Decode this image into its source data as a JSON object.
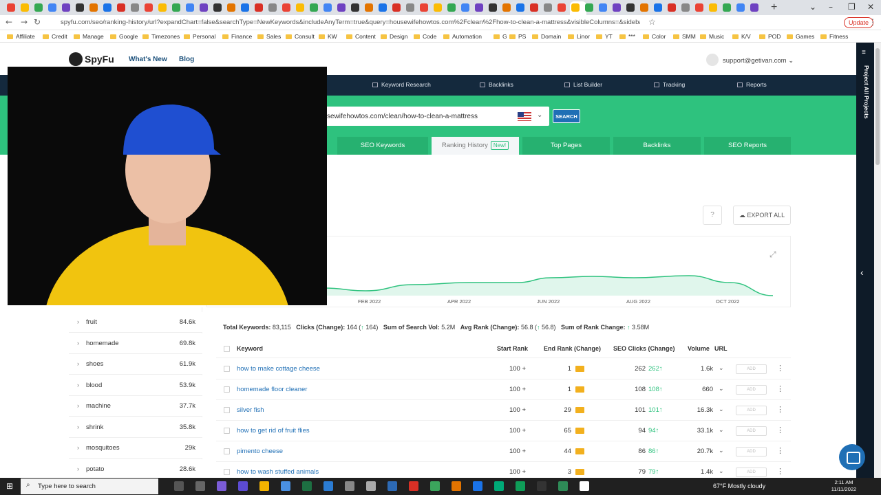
{
  "browser": {
    "url": "spyfu.com/seo/ranking-history/url?expandChart=false&searchType=NewKeywords&includeAnyTerm=true&query=housewifehowtos.com%2Fclean%2Fhow-to-clean-a-mattress&visibleColumns=&sidebarContext=...",
    "update_label": "Update",
    "bookmarks": [
      "Affiliate",
      "Credit",
      "Manage",
      "Google",
      "Timezones",
      "Personal",
      "Finance",
      "Sales",
      "Consult",
      "KW",
      "Content",
      "Design",
      "Code",
      "Automation",
      "G",
      "PS",
      "Domain",
      "Linor",
      "YT",
      "***",
      "Color",
      "SMM",
      "Music",
      "K/V",
      "POD",
      "Games",
      "Fitness"
    ]
  },
  "site": {
    "logo": "SpyFu",
    "links": {
      "whats_new": "What's New",
      "blog": "Blog"
    },
    "account": "support@getivan.com",
    "nav": [
      "Keyword Research",
      "Backlinks",
      "List Builder",
      "Tracking",
      "Reports"
    ],
    "rail_label": "Project All Projects",
    "search": {
      "value": "sewifehowtos.com/clean/how-to-clean-a-mattress",
      "button": "SEARCH"
    },
    "tabs": [
      "SEO Keywords",
      "Ranking History",
      "Top Pages",
      "Backlinks",
      "SEO Reports"
    ],
    "new_badge": "New!",
    "export_label": "EXPORT ALL",
    "help_label": "?"
  },
  "chart_data": {
    "type": "area",
    "x": [
      "FEB 2022",
      "APR 2022",
      "JUN 2022",
      "AUG 2022",
      "OCT 2022"
    ],
    "title": "",
    "xlabel": "",
    "ylabel": ""
  },
  "sidebar_terms": [
    {
      "term": "fruit",
      "count": "84.6k"
    },
    {
      "term": "homemade",
      "count": "69.8k"
    },
    {
      "term": "shoes",
      "count": "61.9k"
    },
    {
      "term": "blood",
      "count": "53.9k"
    },
    {
      "term": "machine",
      "count": "37.7k"
    },
    {
      "term": "shrink",
      "count": "35.8k"
    },
    {
      "term": "mosquitoes",
      "count": "29k"
    },
    {
      "term": "potato",
      "count": "28.6k"
    }
  ],
  "summary": {
    "total_keywords_label": "Total Keywords:",
    "total_keywords": "83,115",
    "clicks_label": "Clicks (Change):",
    "clicks": "164",
    "clicks_change": "164",
    "search_vol_label": "Sum of Search Vol:",
    "search_vol": "5.2M",
    "avg_rank_label": "Avg Rank (Change):",
    "avg_rank": "56.8",
    "avg_rank_change": "56.8",
    "rank_change_label": "Sum of Rank Change:",
    "rank_change": "3.58M"
  },
  "table": {
    "headers": {
      "keyword": "Keyword",
      "start": "Start Rank",
      "end": "End Rank (Change)",
      "clicks": "SEO Clicks (Change)",
      "volume": "Volume",
      "url": "URL"
    },
    "add_label": "ADD",
    "rows": [
      {
        "keyword": "how to make cottage cheese",
        "start": "100 +",
        "end": "1",
        "clicks": "262",
        "change": "262",
        "volume": "1.6k"
      },
      {
        "keyword": "homemade floor cleaner",
        "start": "100 +",
        "end": "1",
        "clicks": "108",
        "change": "108",
        "volume": "660"
      },
      {
        "keyword": "silver fish",
        "start": "100 +",
        "end": "29",
        "clicks": "101",
        "change": "101",
        "volume": "16.3k"
      },
      {
        "keyword": "how to get rid of fruit flies",
        "start": "100 +",
        "end": "65",
        "clicks": "94",
        "change": "94",
        "volume": "33.1k"
      },
      {
        "keyword": "pimento cheese",
        "start": "100 +",
        "end": "44",
        "clicks": "86",
        "change": "86",
        "volume": "20.7k"
      },
      {
        "keyword": "how to wash stuffed animals",
        "start": "100 +",
        "end": "3",
        "clicks": "79",
        "change": "79",
        "volume": "1.4k"
      }
    ]
  },
  "taskbar": {
    "search_placeholder": "Type here to search",
    "weather": "67°F  Mostly cloudy",
    "time": "2:11 AM",
    "date": "11/11/2022"
  },
  "colors": {
    "brand_green": "#2ec27e",
    "nav_dark": "#14293d",
    "link_blue": "#1f6fb5"
  }
}
